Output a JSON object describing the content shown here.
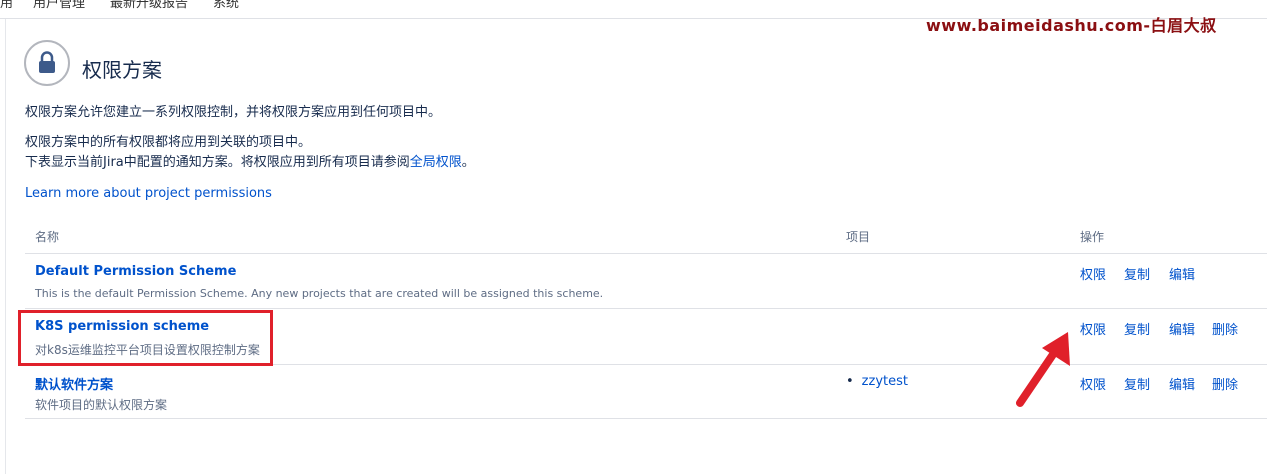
{
  "topnav": {
    "items": [
      "用",
      "用户管理",
      "最新升级报告",
      "系统"
    ]
  },
  "watermark": "www.baimeidashu.com-白眉大叔",
  "page": {
    "title": "权限方案",
    "desc1": "权限方案允许您建立一系列权限控制，并将权限方案应用到任何项目中。",
    "desc2": "权限方案中的所有权限都将应用到关联的项目中。",
    "desc3_prefix": "下表显示当前Jira中配置的通知方案。将权限应用到所有项目请参阅",
    "desc3_link": "全局权限",
    "desc3_suffix": "。",
    "learn_more": "Learn more about project permissions"
  },
  "table": {
    "headers": {
      "name": "名称",
      "project": "项目",
      "actions": "操作"
    },
    "rows": [
      {
        "name": "Default Permission Scheme",
        "description": "This is the default Permission Scheme. Any new projects that are created will be assigned this scheme.",
        "project": "",
        "actions": [
          "权限",
          "复制",
          "编辑"
        ]
      },
      {
        "name": "K8S permission scheme",
        "description": "对k8s运维监控平台项目设置权限控制方案",
        "project": "",
        "actions": [
          "权限",
          "复制",
          "编辑",
          "删除"
        ]
      },
      {
        "name": "默认软件方案",
        "description": "软件项目的默认权限方案",
        "project": "zzytest",
        "actions": [
          "权限",
          "复制",
          "编辑",
          "删除"
        ]
      }
    ]
  },
  "colors": {
    "link": "#0052cc",
    "highlight": "#e0202a",
    "watermark": "#8b0f12"
  },
  "icons": {
    "header": "lock-icon",
    "annotation": "red-arrow-icon"
  }
}
